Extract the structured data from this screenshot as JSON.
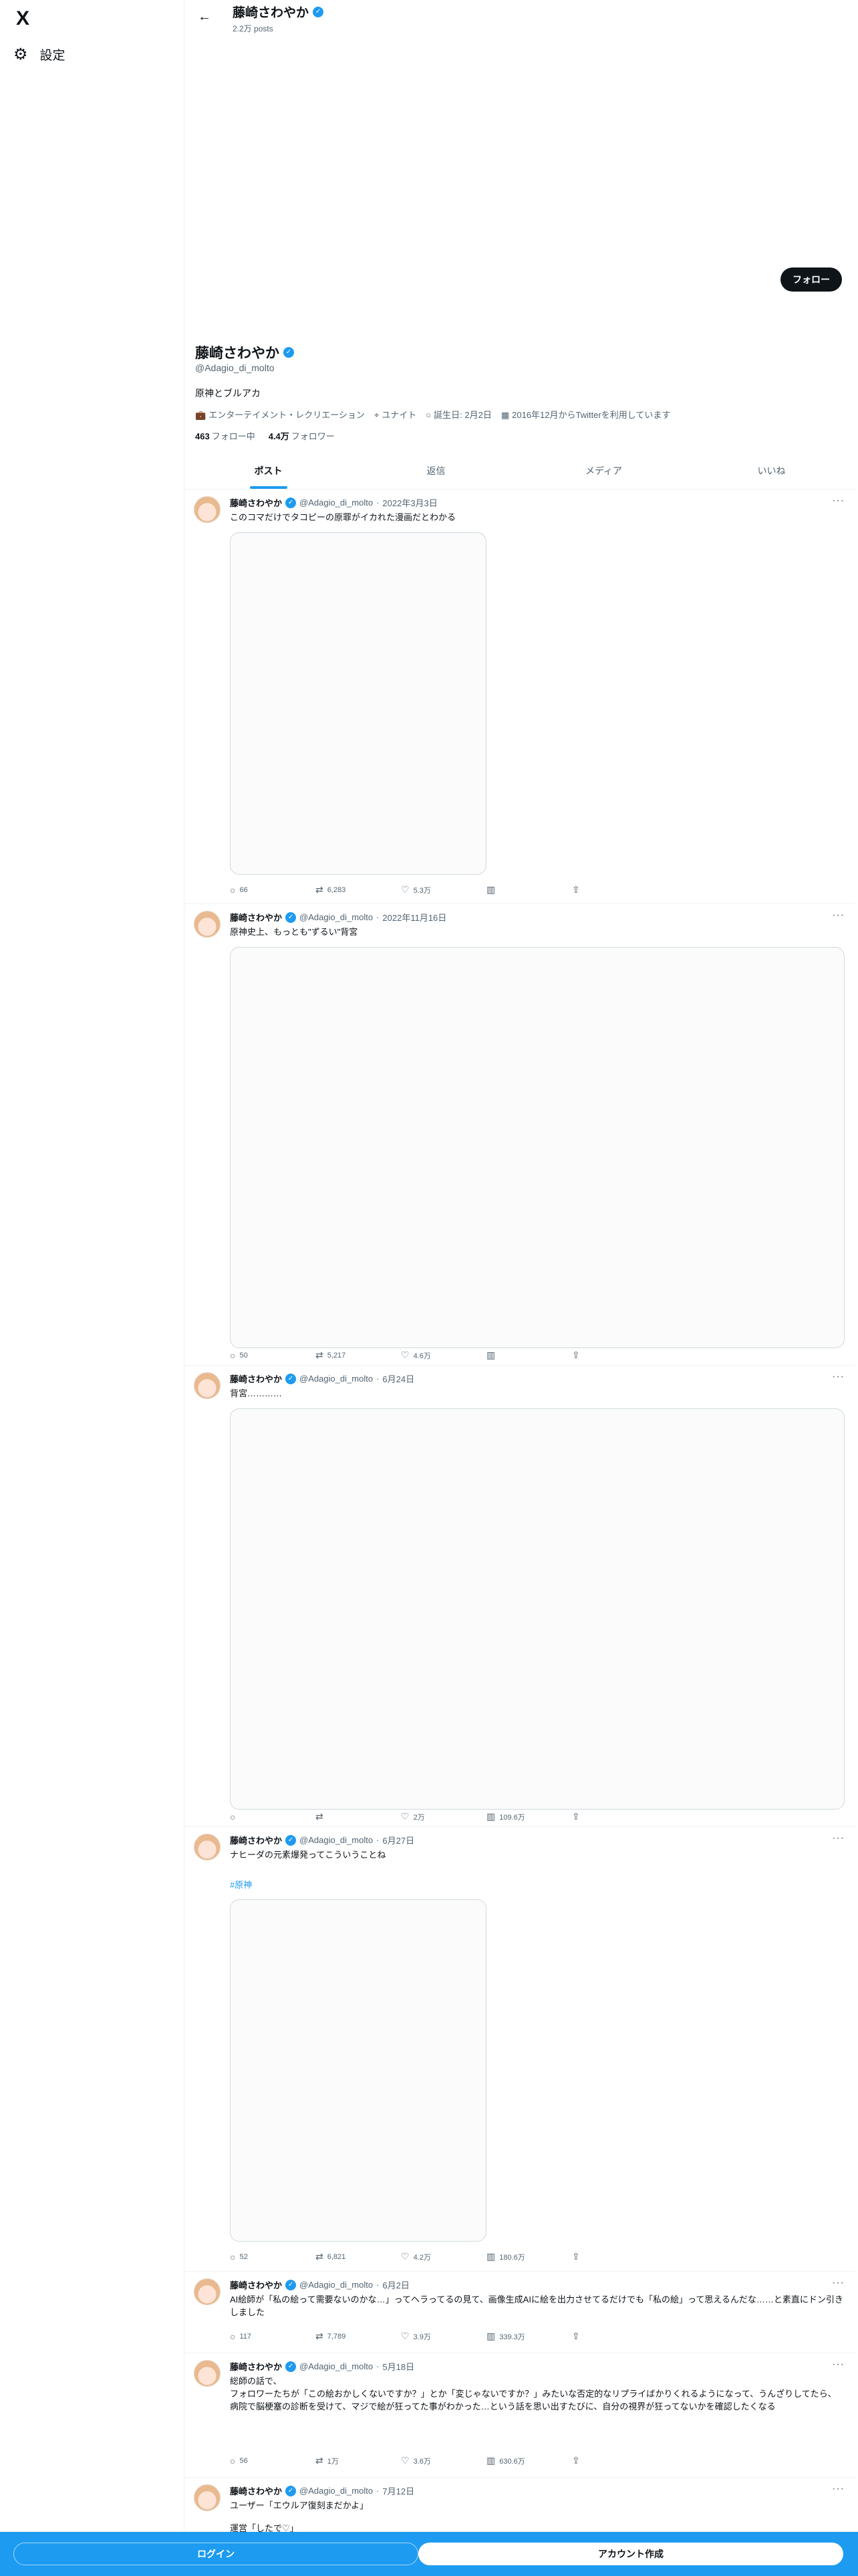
{
  "nav": {
    "logo": "X",
    "settings_label": "設定"
  },
  "header": {
    "name": "藤崎さわやか",
    "posts": "2.2万 posts"
  },
  "profile": {
    "name": "藤崎さわやか",
    "handle": "@Adagio_di_molto",
    "bio": "原神とブルアカ",
    "follow_label": "フォロー",
    "category": "エンターテイメント・レクリエーション",
    "location": "ユナイト",
    "birthday": "誕生日: 2月2日",
    "joined": "2016年12月からTwitterを利用しています",
    "following_count": "463",
    "following_label": "フォロー中",
    "followers_count": "4.4万",
    "followers_label": "フォロワー"
  },
  "tabs": [
    "ポスト",
    "返信",
    "メディア",
    "いいね"
  ],
  "tweets": [
    {
      "name": "藤崎さわやか",
      "handle": "@Adagio_di_molto",
      "date": "2022年3月3日",
      "text": "このコマだけでタコピーの原罪がイカれた漫画だとわかる",
      "replies": "66",
      "reposts": "6,283",
      "likes": "5.3万",
      "views": ""
    },
    {
      "name": "藤崎さわやか",
      "handle": "@Adagio_di_molto",
      "date": "2022年11月16日",
      "text": "原神史上、もっとも\"ずるい\"背宮",
      "replies": "50",
      "reposts": "5,217",
      "likes": "4.6万",
      "views": ""
    },
    {
      "name": "藤崎さわやか",
      "handle": "@Adagio_di_molto",
      "date": "6月24日",
      "text": "背宮…………",
      "replies": "",
      "reposts": "",
      "likes": "2万",
      "views": "109.6万"
    },
    {
      "name": "藤崎さわやか",
      "handle": "@Adagio_di_molto",
      "date": "6月27日",
      "text": "ナヒーダの元素爆発ってこういうことね",
      "link": "#原神",
      "replies": "52",
      "reposts": "6,821",
      "likes": "4.2万",
      "views": "180.6万"
    },
    {
      "name": "藤崎さわやか",
      "handle": "@Adagio_di_molto",
      "date": "6月2日",
      "text": "AI絵師が「私の絵って需要ないのかな…」ってヘラってるの見て、画像生成AIに絵を出力させてるだけでも「私の絵」って思えるんだな……と素直にドン引きしました",
      "replies": "117",
      "reposts": "7,789",
      "likes": "3.9万",
      "views": "339.3万"
    },
    {
      "name": "藤崎さわやか",
      "handle": "@Adagio_di_molto",
      "date": "5月18日",
      "text": "総師の話で、\nフォロワーたちが「この絵おかしくないですか？」とか「変じゃないですか？」みたいな否定的なリプライばかりくれるようになって、うんざりしてたら、\n病院で脳梗塞の診断を受けて、マジで絵が狂ってた事がわかった…という話を思い出すたびに、自分の視界が狂ってないかを確認したくなる",
      "replies": "56",
      "reposts": "1万",
      "likes": "3.6万",
      "views": "630.6万"
    },
    {
      "name": "藤崎さわやか",
      "handle": "@Adagio_di_molto",
      "date": "7月12日",
      "text": "ユーザー「エウルア復刻まだかよ」",
      "text2": "運営「したで♡」"
    }
  ],
  "bottom": {
    "login": "ログイン",
    "signup": "アカウント作成"
  }
}
